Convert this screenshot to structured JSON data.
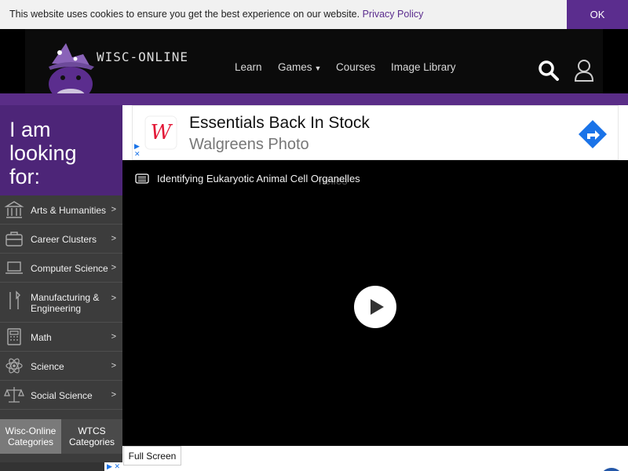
{
  "cookie": {
    "message": "This website uses cookies to ensure you get the best experience on our website.",
    "link": "Privacy Policy",
    "button": "OK"
  },
  "brand": {
    "name": "WISC-ONLINE"
  },
  "nav": {
    "learn": "Learn",
    "games": "Games",
    "courses": "Courses",
    "image_library": "Image Library"
  },
  "sidebar": {
    "heading": "I am looking for:",
    "categories": [
      {
        "label": "Arts & Humanities",
        "icon": "columns-icon"
      },
      {
        "label": "Career Clusters",
        "icon": "briefcase-icon"
      },
      {
        "label": "Computer Science",
        "icon": "laptop-icon"
      },
      {
        "label": "Manufacturing & Engineering",
        "icon": "tools-icon"
      },
      {
        "label": "Math",
        "icon": "calculator-icon"
      },
      {
        "label": "Science",
        "icon": "atom-icon"
      },
      {
        "label": "Social Science",
        "icon": "scales-icon"
      }
    ],
    "arrow": ">",
    "tabs": {
      "wisc": "Wisc-Online Categories",
      "wtcs": "WTCS Categories"
    }
  },
  "ad": {
    "title": "Essentials Back In Stock",
    "subtitle": "Walgreens Photo",
    "brand_mark": "W"
  },
  "video": {
    "title": "Identifying Eukaryotic Animal Cell Organelles",
    "ghost_title": "nelles"
  },
  "controls": {
    "fullscreen": "Full Screen"
  },
  "colors": {
    "purple": "#5b2d8e",
    "ad_red": "#e31837",
    "ad_blue": "#1a73e8"
  }
}
